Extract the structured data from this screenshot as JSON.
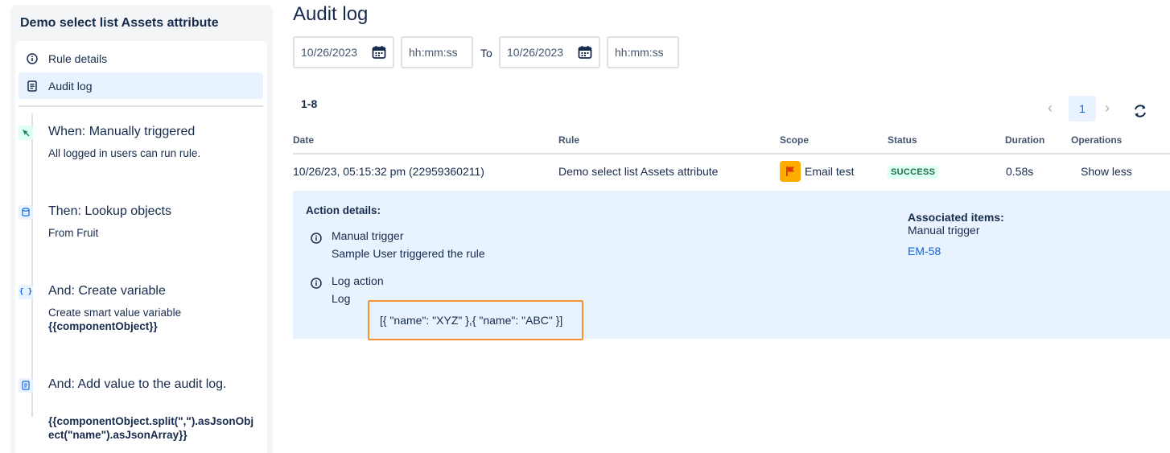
{
  "sidebar": {
    "title": "Demo select list Assets attribute",
    "nav": [
      {
        "label": "Rule details",
        "icon": "info-icon"
      },
      {
        "label": "Audit log",
        "icon": "document-icon"
      }
    ],
    "steps": [
      {
        "title": "When: Manually triggered",
        "desc": "All logged in users can run rule.",
        "icon": "cursor-click-icon",
        "icon_color": "#1f845a",
        "icon_bg": "#dcfff1"
      },
      {
        "title": "Then: Lookup objects",
        "desc": "From Fruit",
        "icon": "database-icon",
        "icon_color": "#0c66e4",
        "icon_bg": "#e9f2ff"
      },
      {
        "title": "And: Create variable",
        "desc": "Create smart value variable",
        "bold": "{{componentObject}}",
        "icon": "braces-icon",
        "icon_glyph": "{ }",
        "icon_color": "#0c66e4",
        "icon_bg": "#e9f2ff"
      },
      {
        "title": "And: Add value to the audit log.",
        "bold": "{{componentObject.split(\",\").asJsonObject(\"name\").asJsonArray}}",
        "icon": "document-icon",
        "icon_color": "#0c66e4",
        "icon_bg": "#e9f2ff"
      }
    ]
  },
  "main": {
    "title": "Audit log",
    "filters": {
      "from_date": "10/26/2023",
      "from_time_placeholder": "hh:mm:ss",
      "to_label": "To",
      "to_date": "10/26/2023",
      "to_time_placeholder": "hh:mm:ss"
    },
    "range": "1-8",
    "pagination": {
      "current_page": "1",
      "prev": "‹",
      "next": "›"
    },
    "columns": [
      "Date",
      "Rule",
      "Scope",
      "Status",
      "Duration",
      "Operations"
    ],
    "row": {
      "date": "10/26/23, 05:15:32 pm (22959360211)",
      "rule": "Demo select list Assets attribute",
      "scope": "Email test",
      "status": "SUCCESS",
      "duration": "0.58s",
      "operation": "Show less"
    },
    "details": {
      "title": "Action details:",
      "actions": [
        {
          "name": "Manual trigger",
          "text": "Sample User triggered the rule"
        },
        {
          "name": "Log action",
          "text": "Log",
          "log_value": "[{ \"name\": \"XYZ\" },{ \"name\": \"ABC\" }]"
        }
      ],
      "associated_title": "Associated items:",
      "associated_sub": "Manual trigger",
      "associated_link": "EM-58"
    }
  },
  "colors": {
    "accent": "#0c66e4",
    "highlight_border": "#f79232",
    "success_bg": "#dcfff1",
    "success_text": "#216e4e",
    "scope_icon_bg": "#ffab00"
  }
}
